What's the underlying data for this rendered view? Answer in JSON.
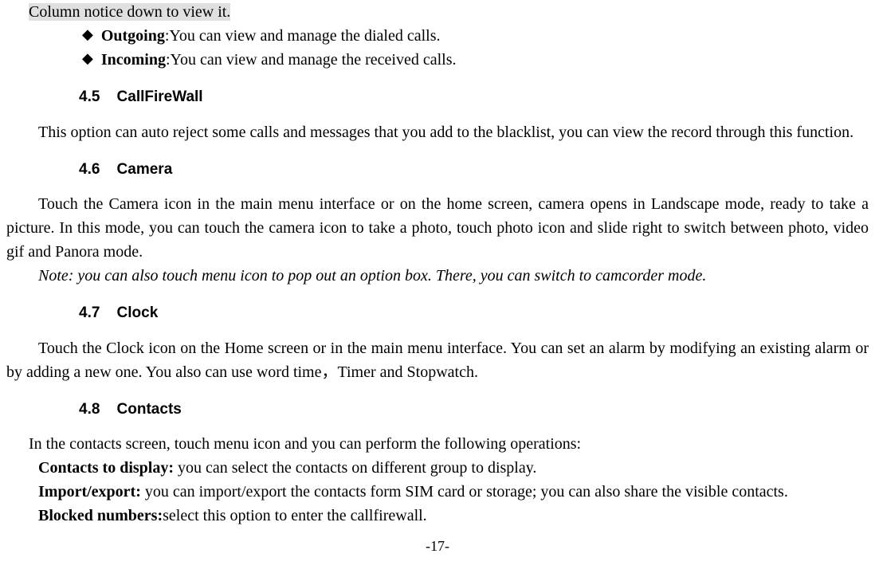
{
  "line1": "Column notice down to view it.",
  "bullets": [
    {
      "label": "Outgoing",
      "text": ":You can view and manage the dialed calls."
    },
    {
      "label": "Incoming",
      "text": ":You can view and manage the received calls."
    }
  ],
  "sections": {
    "s45": {
      "num": "4.5",
      "title": "CallFireWall",
      "body": "This option can auto reject some calls and messages that you add to the blacklist, you can view the record through this function."
    },
    "s46": {
      "num": "4.6",
      "title": "Camera",
      "body1": "Touch the Camera icon in the main menu interface or on the home screen, camera opens in Landscape mode, ready to take a picture. In this mode, you can touch the camera icon to take a photo, touch photo icon and slide right to switch between photo, video gif and Panora mode.",
      "note": "Note: you can also touch menu icon to pop out an option box. There, you can switch to camcorder mode."
    },
    "s47": {
      "num": "4.7",
      "title": "Clock",
      "body": "Touch the Clock icon on the Home screen or in the main menu interface. You can set an alarm by modifying an existing alarm or by adding a new one. You also can use word time，Timer and Stopwatch."
    },
    "s48": {
      "num": "4.8",
      "title": "Contacts",
      "line1": "In the contacts screen, touch menu icon and you can perform the following operations:",
      "item1_label": "Contacts to display: ",
      "item1_text": "you can select the contacts on different group to display.",
      "item2_label": "Import/export: ",
      "item2_text": "you can import/export the contacts form SIM card or storage; you can also share the visible contacts.",
      "item3_label": "Blocked numbers:",
      "item3_text": "select this option to enter the callfirewall."
    }
  },
  "page": "-17-"
}
